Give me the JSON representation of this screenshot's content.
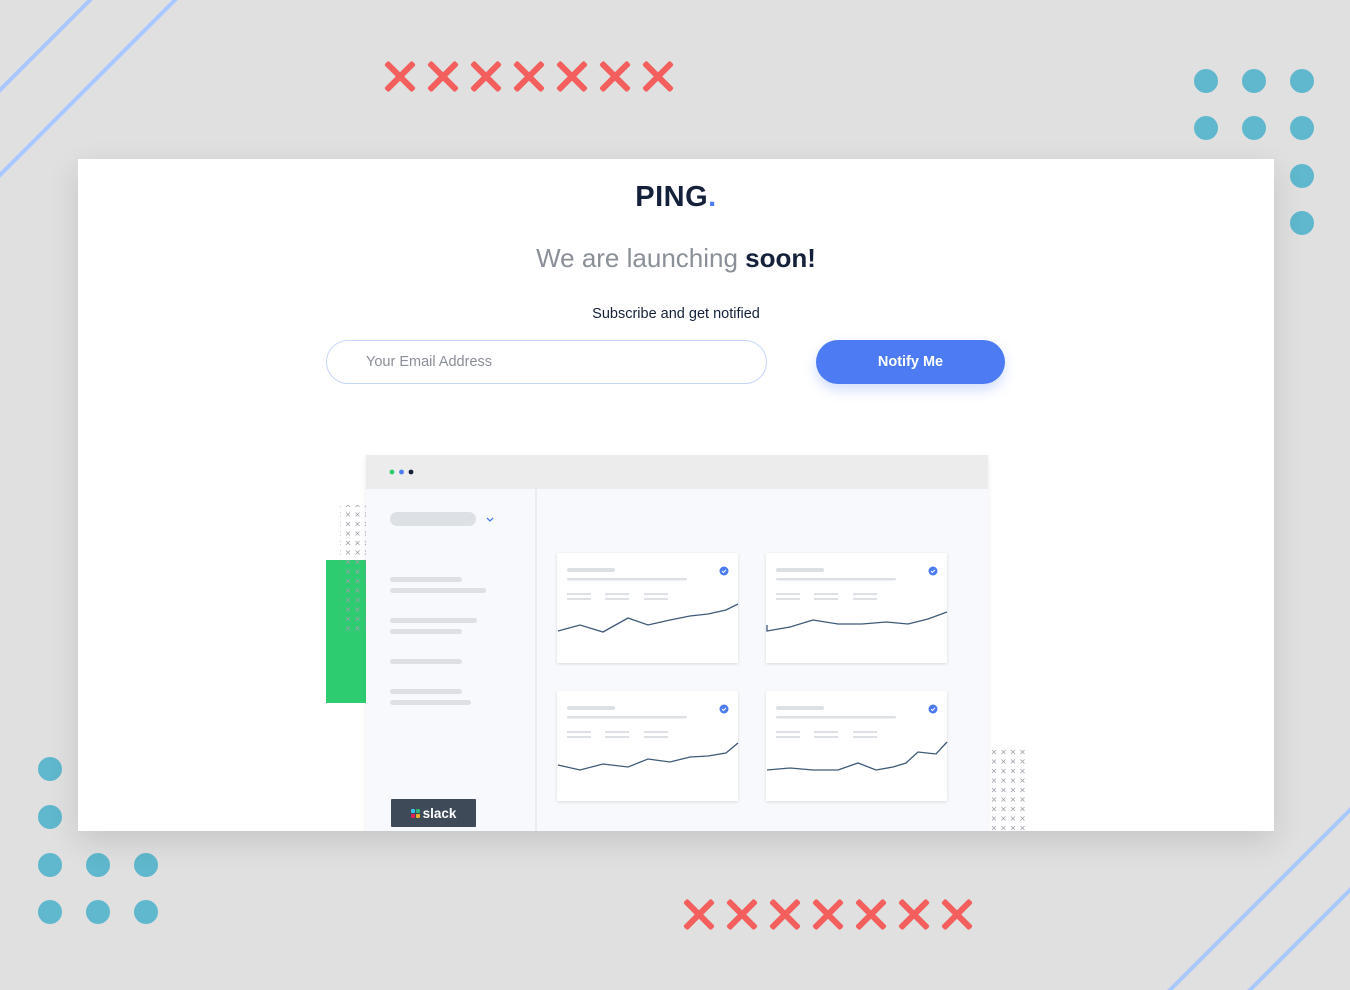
{
  "brand": {
    "name": "PING",
    "dot": ".",
    "accent_color": "#4c7bf3"
  },
  "headline": {
    "lead": "We are launching ",
    "emphasis": "soon!"
  },
  "subtitle": "Subscribe and get notified",
  "form": {
    "email_placeholder": "Your Email Address",
    "email_value": "",
    "submit_label": "Notify Me"
  },
  "illustration": {
    "integration_badge": "slack",
    "sidebar_icon": "chevron-down-icon",
    "dashboard_cards": 4
  },
  "colors": {
    "background": "#e0e0e0",
    "card": "#ffffff",
    "dark_text": "#15213a",
    "muted_text": "#8a8f98",
    "decor_x": "#f25f5c",
    "decor_dots": "#5fb8cd",
    "decor_lines": "#a8c8ff",
    "green_block": "#2ecc71"
  }
}
